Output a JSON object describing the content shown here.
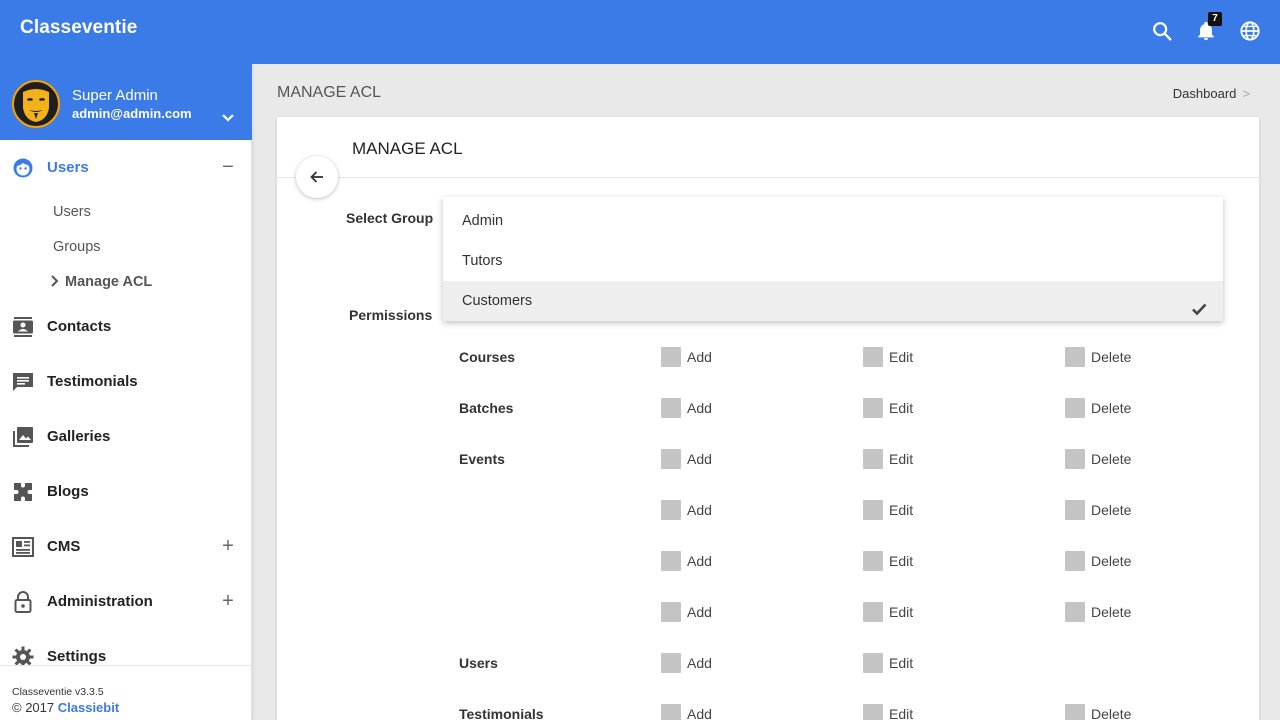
{
  "app": {
    "title": "Classeventie",
    "notification_count": "7"
  },
  "profile": {
    "name": "Super Admin",
    "email": "admin@admin.com"
  },
  "sidebar": {
    "users_section": {
      "label": "Users",
      "children": [
        {
          "label": "Users"
        },
        {
          "label": "Groups"
        },
        {
          "label": "Manage ACL"
        }
      ]
    },
    "items": [
      {
        "label": "Contacts"
      },
      {
        "label": "Testimonials"
      },
      {
        "label": "Galleries"
      },
      {
        "label": "Blogs"
      },
      {
        "label": "CMS"
      },
      {
        "label": "Administration"
      },
      {
        "label": "Settings"
      }
    ],
    "footer": {
      "version": "Classeventie v3.3.5",
      "copyright": "© 2017",
      "company": "Classiebit"
    }
  },
  "header": {
    "page_title": "MANAGE ACL",
    "breadcrumb": "Dashboard",
    "breadcrumb_sep": ">"
  },
  "card": {
    "title": "MANAGE ACL",
    "select_group_label": "Select Group",
    "permissions_label": "Permissions",
    "group_options": [
      {
        "label": "Admin",
        "selected": false
      },
      {
        "label": "Tutors",
        "selected": false
      },
      {
        "label": "Customers",
        "selected": true
      }
    ],
    "permissions": [
      {
        "module": "Courses",
        "actions": [
          "Add",
          "Edit",
          "Delete"
        ]
      },
      {
        "module": "Batches",
        "actions": [
          "Add",
          "Edit",
          "Delete"
        ]
      },
      {
        "module": "Events",
        "actions": [
          "Add",
          "Edit",
          "Delete"
        ]
      },
      {
        "module": "",
        "actions": [
          "Add",
          "Edit",
          "Delete"
        ]
      },
      {
        "module": "",
        "actions": [
          "Add",
          "Edit",
          "Delete"
        ]
      },
      {
        "module": "",
        "actions": [
          "Add",
          "Edit",
          "Delete"
        ]
      },
      {
        "module": "Users",
        "actions": [
          "Add",
          "Edit"
        ]
      },
      {
        "module": "Testimonials",
        "actions": [
          "Add",
          "Edit",
          "Delete"
        ]
      }
    ]
  },
  "colors": {
    "primary": "#3a7be8",
    "checkbox": "#c4c4c4",
    "selected_row": "#eeeeee"
  }
}
